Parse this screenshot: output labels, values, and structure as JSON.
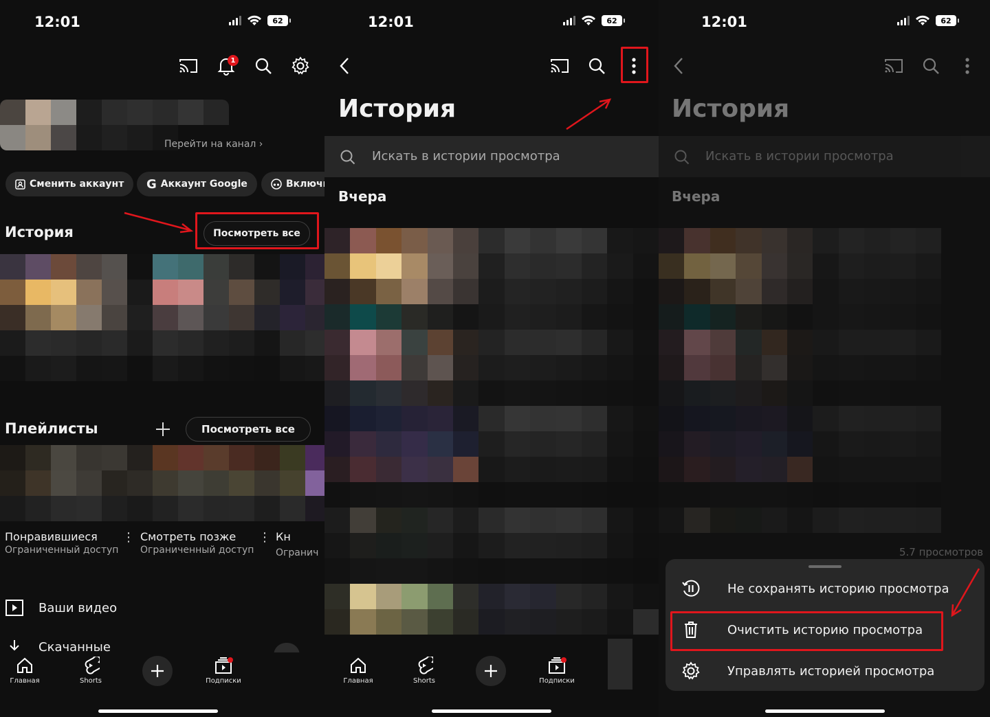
{
  "colors": {
    "background": "#0f0f0f",
    "accent_red": "#e0161c",
    "chip": "#272727",
    "muted_text": "#aaaaaa"
  },
  "panel1": {
    "status": {
      "time": "12:01",
      "battery": "62"
    },
    "header_icons": [
      "cast-icon",
      "bell-icon",
      "search-icon",
      "gear-icon"
    ],
    "notification_count": "1",
    "channel_link": "Перейти на канал ›",
    "chips": [
      "Сменить аккаунт",
      "Аккаунт Google",
      "Включи"
    ],
    "history": {
      "title": "История",
      "view_all": "Посмотреть все"
    },
    "playlists": {
      "title": "Плейлисты",
      "view_all": "Посмотреть все",
      "items": [
        {
          "title": "Понравившиеся",
          "subtitle": "Ограниченный доступ"
        },
        {
          "title": "Смотреть позже",
          "subtitle": "Ограниченный доступ"
        },
        {
          "title": "Кн",
          "subtitle": "Огранич"
        }
      ]
    },
    "menu": [
      {
        "label": "Ваши видео",
        "icon": "play-icon"
      },
      {
        "label": "Скачанные",
        "icon": "download-icon"
      }
    ]
  },
  "tabs": [
    {
      "label": "Главная",
      "icon": "home-icon"
    },
    {
      "label": "Shorts",
      "icon": "shorts-icon"
    },
    {
      "label": "",
      "icon": "plus-icon"
    },
    {
      "label": "Подписки",
      "icon": "subscriptions-icon"
    }
  ],
  "panel2": {
    "status": {
      "time": "12:01",
      "battery": "62"
    },
    "title": "История",
    "search_placeholder": "Искать в истории просмотра",
    "section": "Вчера"
  },
  "panel3": {
    "status": {
      "time": "12:01",
      "battery": "62"
    },
    "title": "История",
    "search_placeholder": "Искать в истории просмотра",
    "section": "Вчера",
    "views_fragment": "5.7 просмотров",
    "sheet": [
      {
        "label": "Не сохранять историю просмотра",
        "icon": "pause-history-icon"
      },
      {
        "label": "Очистить историю просмотра",
        "icon": "trash-icon"
      },
      {
        "label": "Управлять историей просмотра",
        "icon": "gear-icon"
      }
    ]
  }
}
